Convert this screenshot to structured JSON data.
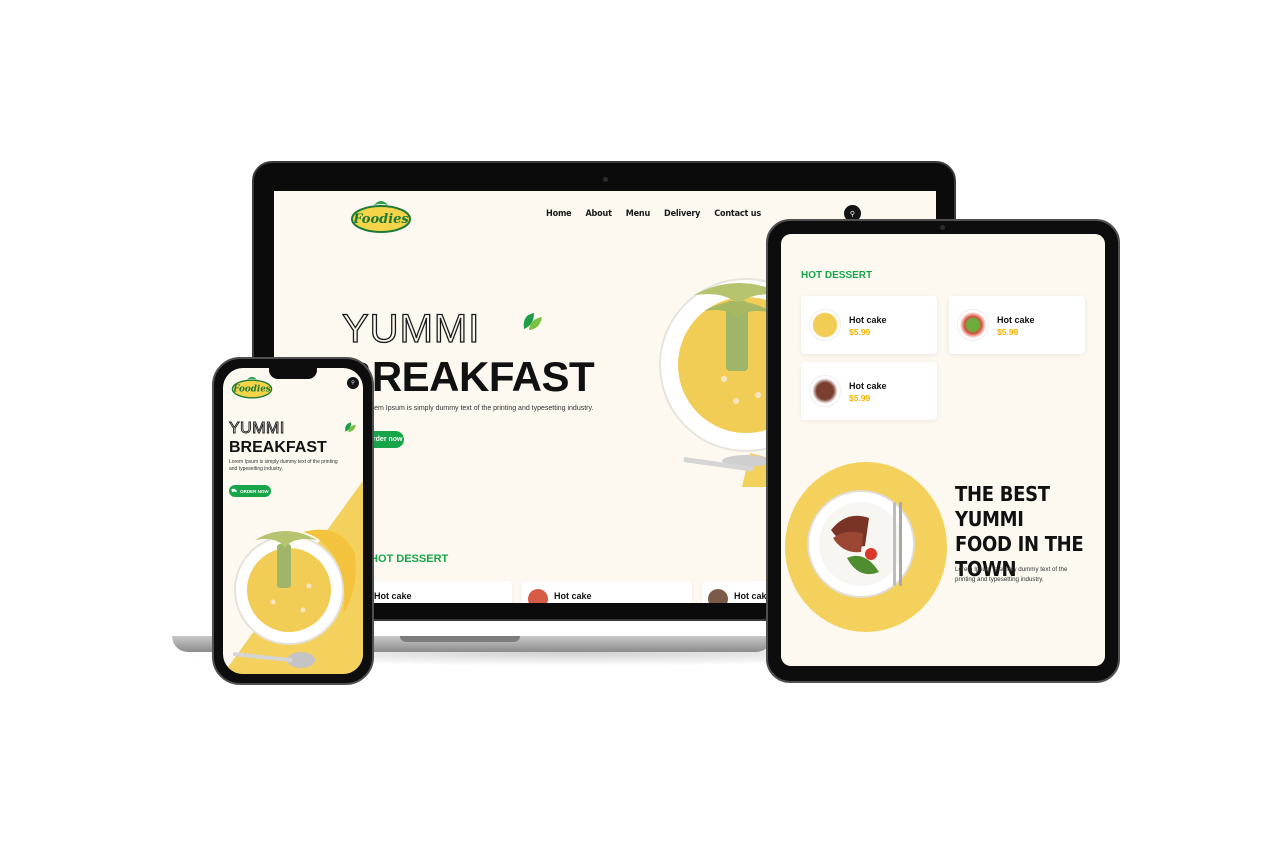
{
  "brand": {
    "logo_text": "Foodies",
    "accent_green": "#18a54a",
    "accent_yellow": "#f3d15c",
    "price_color": "#f1b400"
  },
  "laptop": {
    "nav": [
      "Home",
      "About",
      "Menu",
      "Delivery",
      "Contact us"
    ],
    "hero_outline": "YUMMI",
    "hero_title": "BREAKFAST",
    "hero_desc": "Lorem Ipsum is simply dummy text of the printing and typesetting industry.",
    "cta": "Order now",
    "section_title": "HOT DESSERT",
    "cards": [
      "Hot cake",
      "Hot cake",
      "Hot cake"
    ]
  },
  "phone": {
    "hero_outline": "YUMMI",
    "hero_title": "BREAKFAST",
    "hero_desc": "Lorem Ipsum is simply dummy text of the printing and typesetting industry.",
    "cta": "ORDER NOW"
  },
  "tablet": {
    "section_title": "HOT DESSERT",
    "items": [
      {
        "name": "Hot cake",
        "price": "$5.99"
      },
      {
        "name": "Hot cake",
        "price": "$5.99"
      },
      {
        "name": "Hot cake",
        "price": "$5.99"
      }
    ],
    "promo_title": "THE BEST YUMMI FOOD IN THE TOWN",
    "promo_desc": "Lorem Ipsum is simply dummy text of the printing and typesetting industry."
  }
}
